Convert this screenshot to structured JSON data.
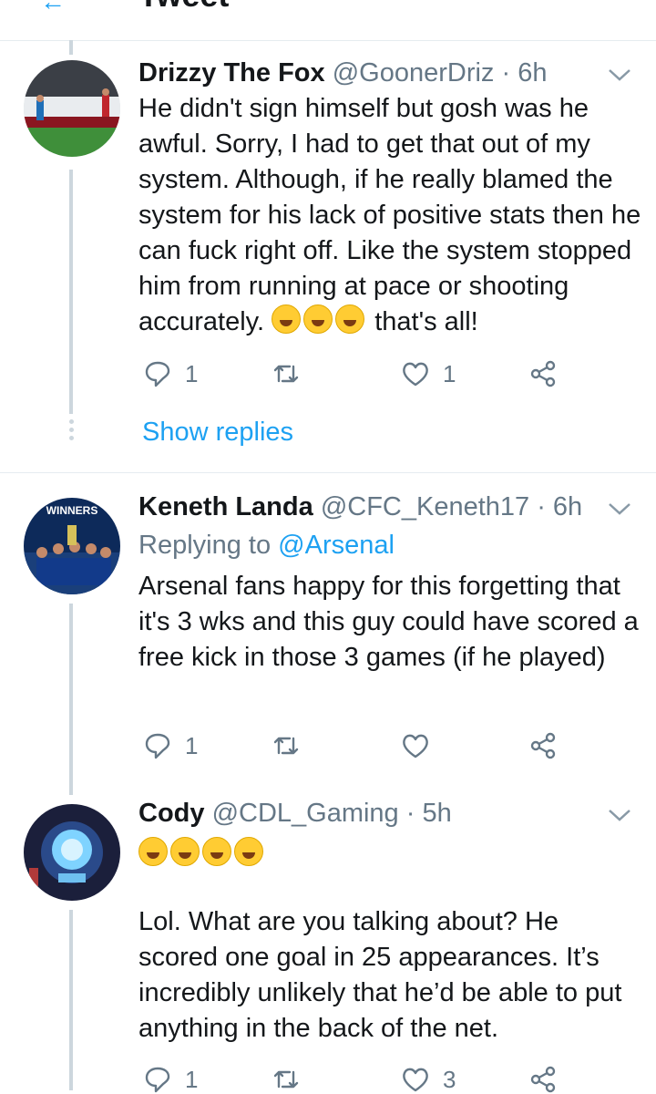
{
  "header": {
    "title": "Tweet"
  },
  "colors": {
    "accent": "#1da1f2",
    "text": "#14171a",
    "secondary": "#657786",
    "line": "#ccd6dd"
  },
  "tweets": [
    {
      "name": "Drizzy The Fox",
      "handle": "@GoonerDriz",
      "time": "· 6h",
      "replying_label": "",
      "replying_to": "",
      "text": "He didn't sign himself but gosh was he awful. Sorry, I had to get that out of my system. Although, if he really blamed the system for his lack of positive stats then he can fuck right off. Like the system stopped him from running at pace or shooting accurately.",
      "text_tail": "that's all!",
      "actions": {
        "reply_count": "1",
        "retweet_count": "",
        "like_count": "1"
      },
      "show_replies": "Show replies"
    },
    {
      "name": "Keneth Landa",
      "handle": "@CFC_Keneth17",
      "time": "· 6h",
      "replying_label": "Replying to",
      "replying_to": "@Arsenal",
      "avatar_text": "WINNERS",
      "text": "Arsenal fans happy for this forgetting that it's 3 wks and this guy could have scored a free kick in those 3 games (if he played)",
      "actions": {
        "reply_count": "1",
        "retweet_count": "",
        "like_count": ""
      }
    },
    {
      "name": "Cody",
      "handle": "@CDL_Gaming",
      "time": "· 5h",
      "text": "Lol. What are you talking about? He scored one goal in 25 appearances. It’s incredibly unlikely that he’d be able to put anything in the back of the net.",
      "actions": {
        "reply_count": "1",
        "retweet_count": "",
        "like_count": "3"
      }
    }
  ]
}
